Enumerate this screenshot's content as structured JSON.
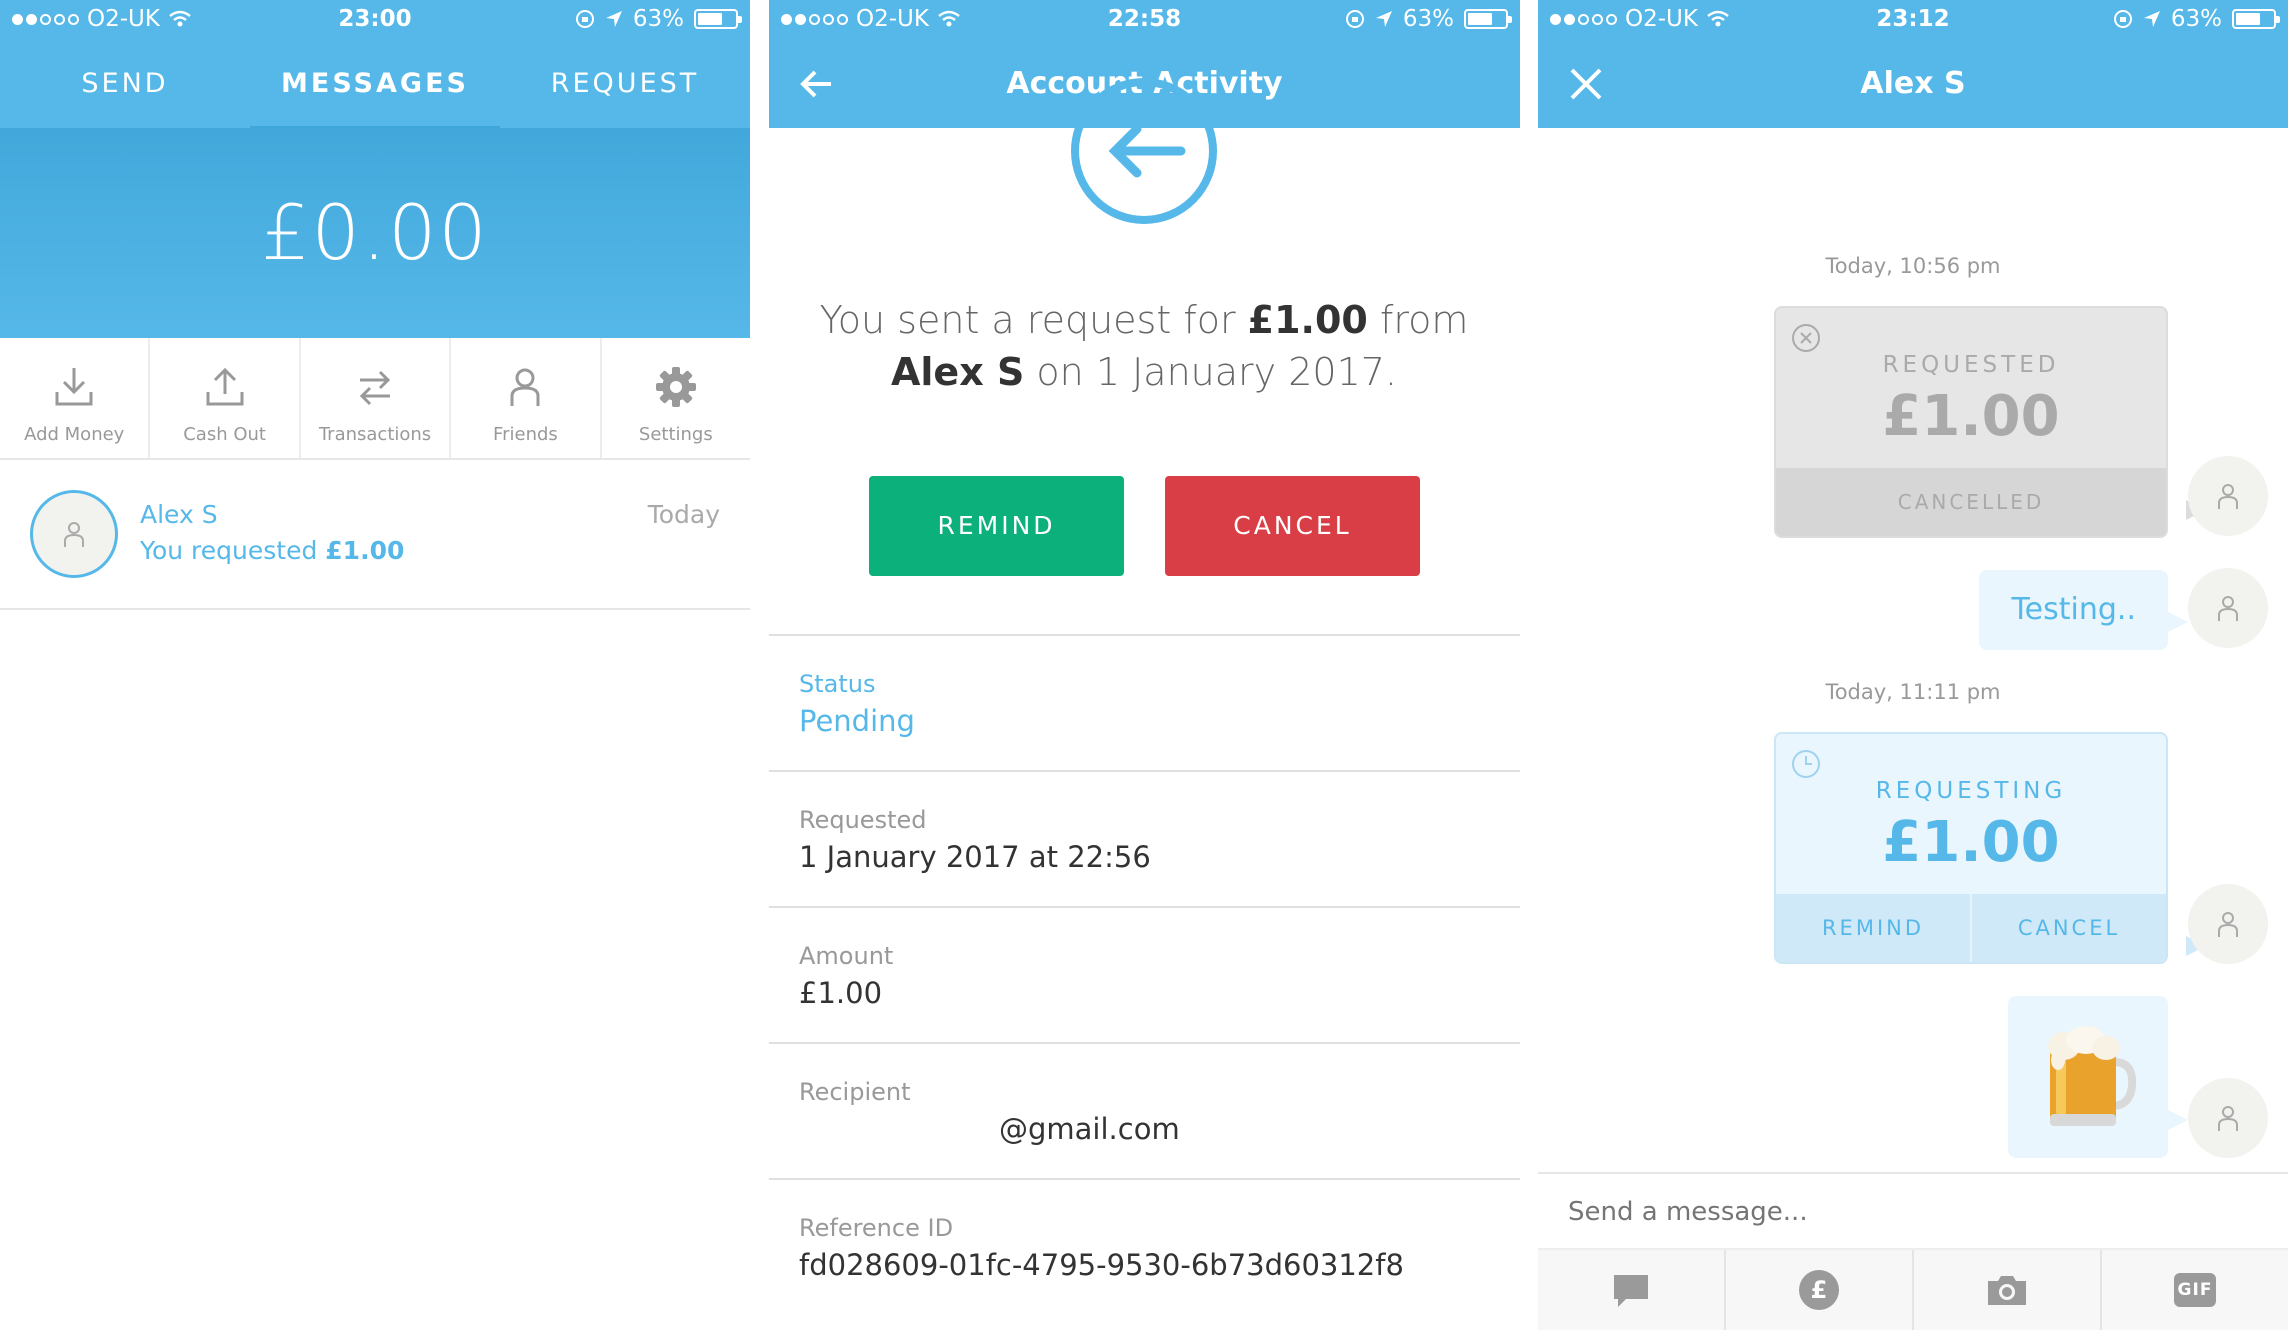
{
  "colors": {
    "brand": "#55b8e8",
    "remind_green": "#0cb07b",
    "cancel_red": "#d93e46"
  },
  "screen1": {
    "status": {
      "carrier": "O2-UK",
      "time": "23:00",
      "battery": "63%"
    },
    "tabs": [
      "SEND",
      "MESSAGES",
      "REQUEST"
    ],
    "balance": "£0.00",
    "actions": [
      {
        "label": "Add Money",
        "icon": "download-icon"
      },
      {
        "label": "Cash Out",
        "icon": "upload-icon"
      },
      {
        "label": "Transactions",
        "icon": "swap-arrows-icon"
      },
      {
        "label": "Friends",
        "icon": "person-icon"
      },
      {
        "label": "Settings",
        "icon": "gear-icon"
      }
    ],
    "conversation": {
      "name": "Alex S",
      "preview_prefix": "You requested ",
      "preview_amount": "£1.00",
      "time": "Today"
    }
  },
  "screen2": {
    "status": {
      "carrier": "O2-UK",
      "time": "22:58",
      "battery": "63%"
    },
    "title": "Account Activity",
    "sentence": {
      "p1": "You sent a request for ",
      "amount": "£1.00",
      "p2": " from ",
      "name": "Alex S",
      "p3": " on 1 January 2017."
    },
    "buttons": {
      "remind": "REMIND",
      "cancel": "CANCEL"
    },
    "details": [
      {
        "key": "Status",
        "value": "Pending"
      },
      {
        "key": "Requested",
        "value": "1 January 2017 at 22:56"
      },
      {
        "key": "Amount",
        "value": "£1.00"
      },
      {
        "key": "Recipient",
        "value": "@gmail.com"
      },
      {
        "key": "Reference ID",
        "value": "fd028609-01fc-4795-9530-6b73d60312f8"
      }
    ]
  },
  "screen3": {
    "status": {
      "carrier": "O2-UK",
      "time": "23:12",
      "battery": "63%"
    },
    "title": "Alex S",
    "time1": "Today, 10:56 pm",
    "card1": {
      "title": "REQUESTED",
      "amount": "£1.00",
      "footer": "CANCELLED"
    },
    "message": "Testing..",
    "time2": "Today, 11:11 pm",
    "card2": {
      "title": "REQUESTING",
      "amount": "£1.00",
      "remind": "REMIND",
      "cancel": "CANCEL"
    },
    "composer_placeholder": "Send a message...",
    "toolbar": {
      "gif": "GIF"
    }
  }
}
